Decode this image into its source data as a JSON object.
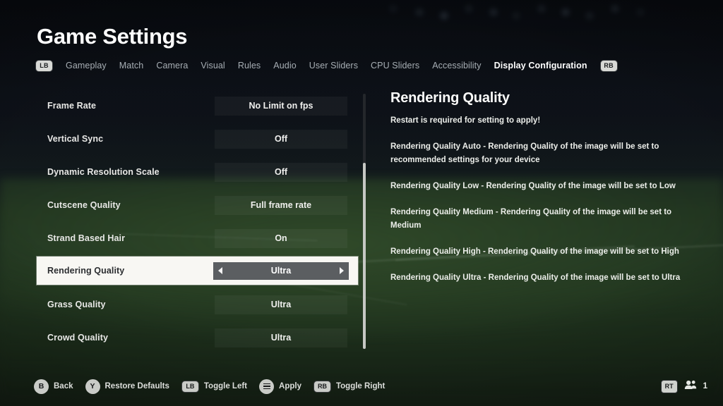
{
  "header": {
    "title": "Game Settings",
    "left_bumper": "LB",
    "right_bumper": "RB",
    "tabs": [
      {
        "label": "Gameplay",
        "active": false
      },
      {
        "label": "Match",
        "active": false
      },
      {
        "label": "Camera",
        "active": false
      },
      {
        "label": "Visual",
        "active": false
      },
      {
        "label": "Rules",
        "active": false
      },
      {
        "label": "Audio",
        "active": false
      },
      {
        "label": "User Sliders",
        "active": false
      },
      {
        "label": "CPU Sliders",
        "active": false
      },
      {
        "label": "Accessibility",
        "active": false
      },
      {
        "label": "Display Configuration",
        "active": true
      }
    ]
  },
  "settings": {
    "rows": [
      {
        "label": "Frame Rate",
        "value": "No Limit on fps",
        "selected": false
      },
      {
        "label": "Vertical Sync",
        "value": "Off",
        "selected": false
      },
      {
        "label": "Dynamic Resolution Scale",
        "value": "Off",
        "selected": false
      },
      {
        "label": "Cutscene Quality",
        "value": "Full frame rate",
        "selected": false
      },
      {
        "label": "Strand Based Hair",
        "value": "On",
        "selected": false
      },
      {
        "label": "Rendering Quality",
        "value": "Ultra",
        "selected": true
      },
      {
        "label": "Grass Quality",
        "value": "Ultra",
        "selected": false
      },
      {
        "label": "Crowd Quality",
        "value": "Ultra",
        "selected": false
      }
    ]
  },
  "detail": {
    "title": "Rendering Quality",
    "note": "Restart is required for setting to apply!",
    "paragraphs": [
      "Rendering Quality Auto - Rendering Quality of the image will be set to recommended settings for your device",
      "Rendering Quality Low - Rendering Quality of the image will be set to Low",
      "Rendering Quality Medium - Rendering Quality of the image will be set to Medium",
      "Rendering Quality High - Rendering Quality of the image will be set to High",
      "Rendering Quality Ultra - Rendering Quality of the image will be set to Ultra"
    ]
  },
  "footer": {
    "hints": [
      {
        "button": "B",
        "label": "Back",
        "type": "round"
      },
      {
        "button": "Y",
        "label": "Restore Defaults",
        "type": "round"
      },
      {
        "button": "LB",
        "label": "Toggle Left",
        "type": "bumper"
      },
      {
        "button": "",
        "label": "Apply",
        "type": "menu"
      },
      {
        "button": "RB",
        "label": "Toggle Right",
        "type": "bumper"
      }
    ],
    "trigger": "RT",
    "players": "1"
  },
  "colors": {
    "highlight_row": "#f8f7f3",
    "selector_chip": "#5b5e61",
    "accent_text": "#ffffff",
    "pitch_green": "#20341f"
  }
}
